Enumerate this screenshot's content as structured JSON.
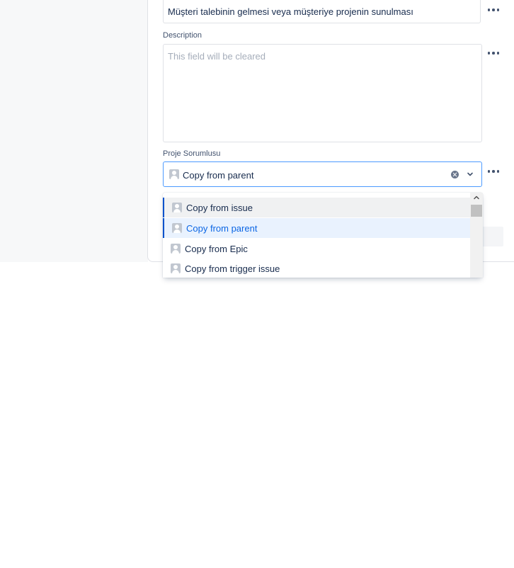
{
  "summary_field": {
    "value": "Müşteri talebinin gelmesi veya müşteriye projenin sunulması"
  },
  "description_field": {
    "label": "Description",
    "placeholder": "This field will be cleared"
  },
  "proje_sorumlusu_field": {
    "label": "Proje Sorumlusu",
    "value": "Copy from parent"
  },
  "dropdown": {
    "options": [
      {
        "label": "Copy from issue",
        "state": "hover"
      },
      {
        "label": "Copy from parent",
        "state": "selected"
      },
      {
        "label": "Copy from Epic",
        "state": "normal"
      },
      {
        "label": "Copy from trigger issue",
        "state": "normal"
      }
    ]
  },
  "icons": {
    "more": "more-horizontal-icon",
    "avatar": "user-avatar-icon",
    "clear": "clear-icon",
    "chevron": "chevron-down-icon",
    "scroll_up": "chevron-up-icon"
  },
  "colors": {
    "focus_border": "#4c9aff",
    "selected_bg": "#e9f2fe",
    "selected_text": "#0c66e4",
    "accent": "#0052cc"
  }
}
